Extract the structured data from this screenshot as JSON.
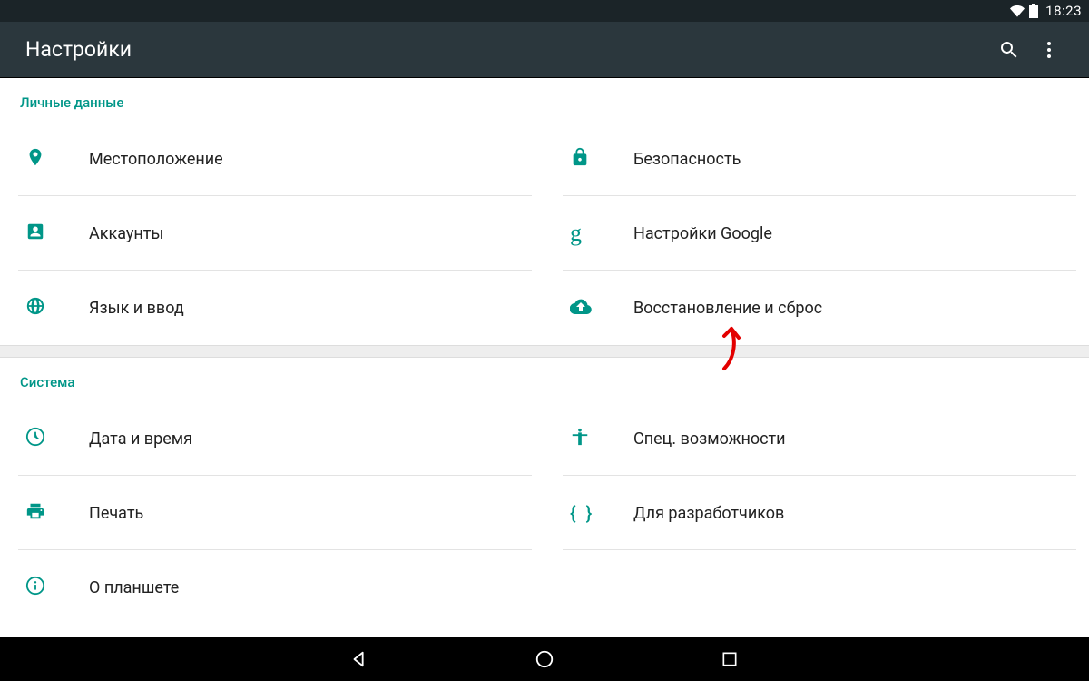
{
  "status": {
    "time": "18:23"
  },
  "appbar": {
    "title": "Настройки"
  },
  "sections": {
    "personal": {
      "header": "Личные данные",
      "items": {
        "location": "Местоположение",
        "security": "Безопасность",
        "accounts": "Аккаунты",
        "google": "Настройки Google",
        "language": "Язык и ввод",
        "backup": "Восстановление и сброс"
      }
    },
    "system": {
      "header": "Система",
      "items": {
        "datetime": "Дата и время",
        "accessibility": "Спец. возможности",
        "printing": "Печать",
        "developer": "Для разработчиков",
        "about": "О планшете"
      }
    }
  },
  "colors": {
    "accent": "#009688",
    "appbar": "#2b373d",
    "statusbar": "#1b2428"
  }
}
